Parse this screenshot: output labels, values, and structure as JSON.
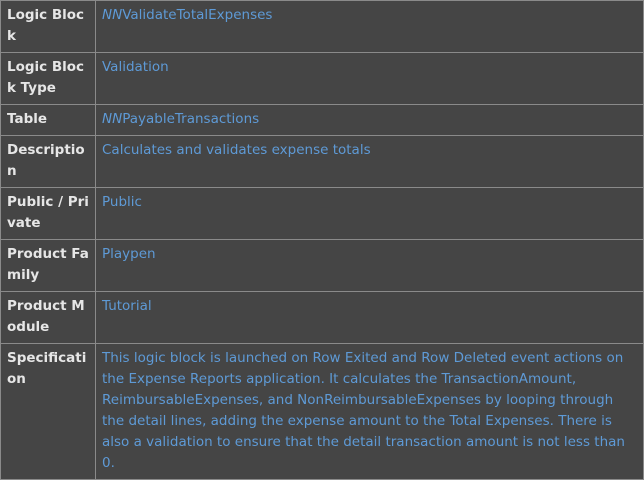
{
  "rows": [
    {
      "key": "Logic Block",
      "prefix": "NN",
      "value": "ValidateTotalExpenses"
    },
    {
      "key": "Logic Block Type",
      "value": "Validation"
    },
    {
      "key": "Table",
      "prefix": "NN",
      "value": "PayableTransactions"
    },
    {
      "key": "Description",
      "value": "Calculates and validates expense totals"
    },
    {
      "key": "Public / Private",
      "value": "Public"
    },
    {
      "key": "Product Family",
      "value": "Playpen"
    },
    {
      "key": "Product Module",
      "value": "Tutorial"
    },
    {
      "key": "Specification",
      "value": "This logic block is launched on Row Exited and Row Deleted event actions on the Expense Reports application. It calculates the TransactionAmount, ReimbursableExpenses, and NonReimbursableExpenses by looping through the detail lines, adding the expense amount to the Total Expenses. There is also a validation to ensure that the detail transaction amount is not less than 0."
    }
  ]
}
